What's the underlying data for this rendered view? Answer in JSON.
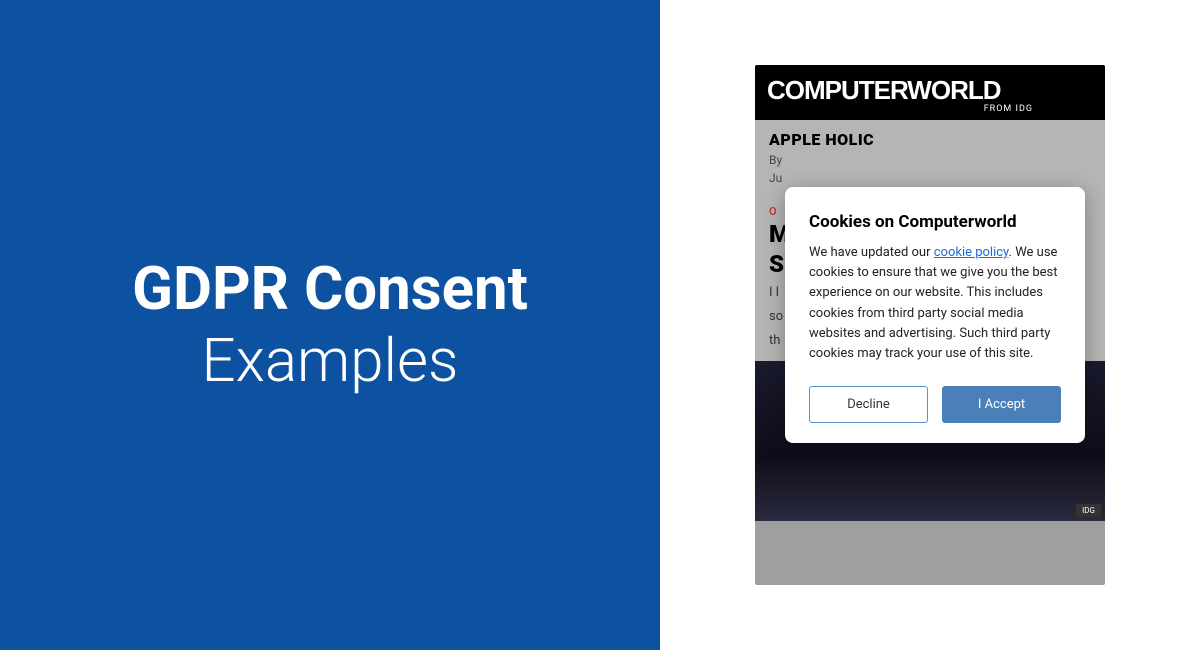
{
  "hero": {
    "title_bold": "GDPR Consent",
    "title_light": "Examples"
  },
  "phone": {
    "site_logo": "COMPUTERWORLD",
    "site_tagline": "FROM IDG",
    "article": {
      "category": "APPLE HOLIC",
      "byline": "By",
      "date": "Ju",
      "badge": "O",
      "title_1": "M",
      "title_2": "S",
      "excerpt_1": "I l",
      "excerpt_2": "so",
      "excerpt_3": "th"
    },
    "idg_badge": "IDG"
  },
  "modal": {
    "title": "Cookies on Computerworld",
    "body_prefix": "We have updated our ",
    "link_text": "cookie policy",
    "body_suffix": ". We use cookies to ensure that we give you the best experience on our website. This includes cookies from third party social media websites and advertising. Such third party cookies may track your use of this site.",
    "decline": "Decline",
    "accept": "I Accept"
  }
}
